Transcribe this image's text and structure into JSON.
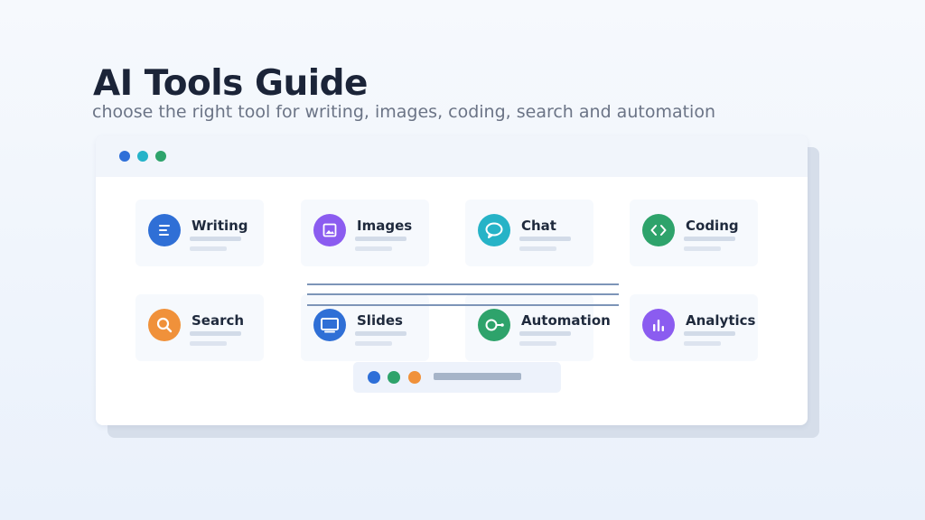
{
  "header": {
    "title": "AI Tools Guide",
    "subtitle": "choose the right tool for writing, images, coding, search and automation"
  },
  "window": {
    "traffic_colors": [
      "#2e6fd8",
      "#25b3c9",
      "#2ea36b"
    ]
  },
  "tools": [
    {
      "label": "Writing",
      "icon": "text-lines-icon",
      "color": "#2f6fd6"
    },
    {
      "label": "Images",
      "icon": "image-icon",
      "color": "#8b5cf0"
    },
    {
      "label": "Chat",
      "icon": "chat-bubble-icon",
      "color": "#26b3c7"
    },
    {
      "label": "Coding",
      "icon": "code-brackets-icon",
      "color": "#2ea36b"
    },
    {
      "label": "Search",
      "icon": "magnifier-icon",
      "color": "#f0913a"
    },
    {
      "label": "Slides",
      "icon": "monitor-icon",
      "color": "#2f6fd6"
    },
    {
      "label": "Automation",
      "icon": "workflow-icon",
      "color": "#2ea36b"
    },
    {
      "label": "Analytics",
      "icon": "bar-chart-icon",
      "color": "#8b5cf0"
    }
  ],
  "bottom_bar": {
    "dot_colors": [
      "#2e6fd8",
      "#2ea36b",
      "#f0913a"
    ]
  }
}
